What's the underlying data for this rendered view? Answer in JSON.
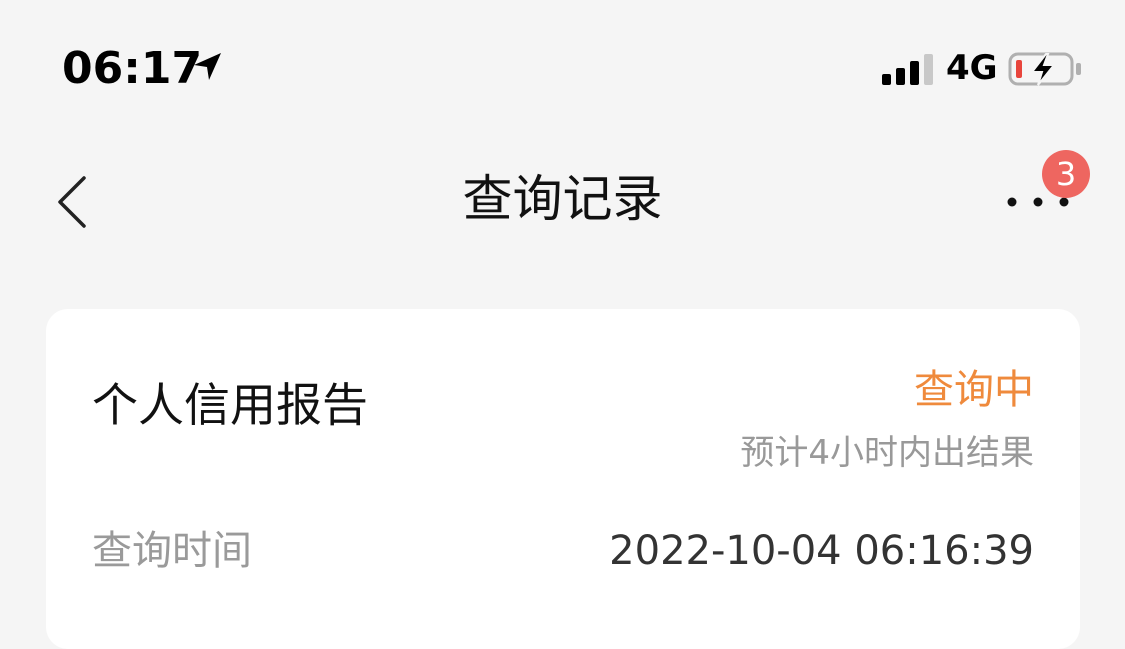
{
  "status_bar": {
    "time": "06:17",
    "network": "4G",
    "icons": {
      "location": "location-arrow-icon",
      "signal": "cellular-signal-icon",
      "battery": "battery-charging-icon"
    }
  },
  "nav": {
    "title": "查询记录",
    "badge_count": "3",
    "icons": {
      "back": "chevron-left-icon",
      "more": "more-dots-icon"
    }
  },
  "record": {
    "title": "个人信用报告",
    "status": "查询中",
    "status_hint": "预计4小时内出结果",
    "time_label": "查询时间",
    "time_value": "2022-10-04 06:16:39"
  },
  "colors": {
    "background": "#f5f5f5",
    "card": "#ffffff",
    "status_accent": "#ef8a3c",
    "badge": "#ee6660",
    "secondary_text": "#999999"
  }
}
